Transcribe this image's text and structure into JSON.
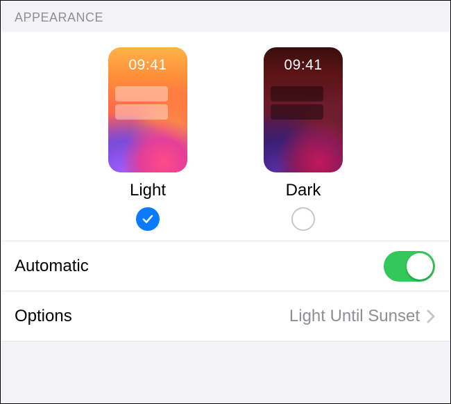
{
  "section_header": "APPEARANCE",
  "appearance": {
    "time_display": "09:41",
    "options": [
      {
        "key": "light",
        "label": "Light",
        "selected": true
      },
      {
        "key": "dark",
        "label": "Dark",
        "selected": false
      }
    ]
  },
  "automatic": {
    "label": "Automatic",
    "enabled": true
  },
  "options_row": {
    "label": "Options",
    "value": "Light Until Sunset"
  },
  "colors": {
    "accent_blue": "#0a7aff",
    "switch_green": "#34c759",
    "secondary_text": "#8e8e93"
  }
}
